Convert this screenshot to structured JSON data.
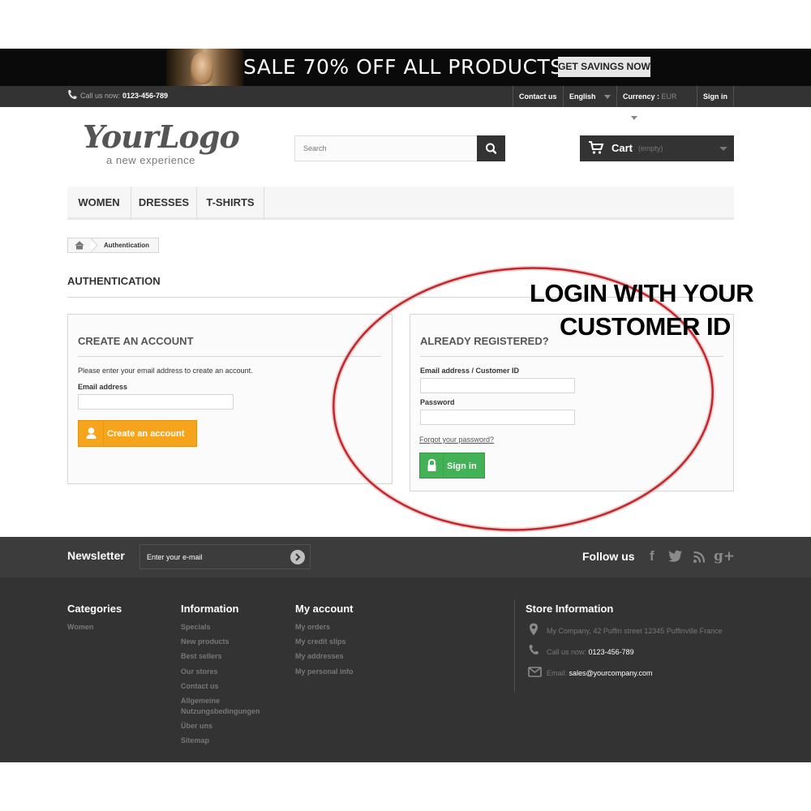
{
  "banner": {
    "headline": "SALE 70% OFF ALL PRODUCTS",
    "cta": "GET SAVINGS NOW"
  },
  "topbar": {
    "call_label": "Call us now:",
    "phone": "0123-456-789",
    "contact": "Contact us",
    "language": "English",
    "currency_label": "Currency :",
    "currency_value": "EUR",
    "signin": "Sign in"
  },
  "header": {
    "logo_main": "YourLogo",
    "logo_sub": "a new experience",
    "search_placeholder": "Search",
    "cart_label": "Cart",
    "cart_status": "(empty)"
  },
  "menu": {
    "items": [
      "WOMEN",
      "DRESSES",
      "T-SHIRTS"
    ]
  },
  "breadcrumb": {
    "current": "Authentication"
  },
  "page": {
    "heading": "AUTHENTICATION"
  },
  "create_account": {
    "title": "CREATE AN ACCOUNT",
    "instructions": "Please enter your email address to create an account.",
    "email_label": "Email address",
    "button": "Create an account"
  },
  "sign_in": {
    "title": "ALREADY REGISTERED?",
    "email_label": "Email address / Customer ID",
    "password_label": "Password",
    "forgot": "Forgot your password?",
    "button": "Sign in"
  },
  "annotation": {
    "line1": "LOGIN WITH YOUR",
    "line2": "CUSTOMER ID",
    "color": "#c0282d"
  },
  "newsletter": {
    "title": "Newsletter",
    "placeholder": "Enter your e-mail",
    "follow": "Follow us",
    "social_icons": [
      "facebook-icon",
      "twitter-icon",
      "rss-icon",
      "google-plus-icon"
    ]
  },
  "footer": {
    "categories": {
      "title": "Categories",
      "links": [
        "Women"
      ]
    },
    "information": {
      "title": "Information",
      "links": [
        "Specials",
        "New products",
        "Best sellers",
        "Our stores",
        "Contact us",
        "Allgemeine Nutzungsbedingungen",
        "Über uns",
        "Sitemap"
      ]
    },
    "my_account": {
      "title": "My account",
      "links": [
        "My orders",
        "My credit slips",
        "My addresses",
        "My personal info"
      ]
    },
    "store": {
      "title": "Store Information",
      "address": "My Company, 42 Puffin street 12345 Puffinville France",
      "call_label": "Call us now:",
      "phone": "0123-456-789",
      "email_label": "Email:",
      "email": "sales@yourcompany.com"
    }
  },
  "colors": {
    "dark_bar": "#333333",
    "create_button": "#f7a41d",
    "signin_button": "#43b155"
  }
}
